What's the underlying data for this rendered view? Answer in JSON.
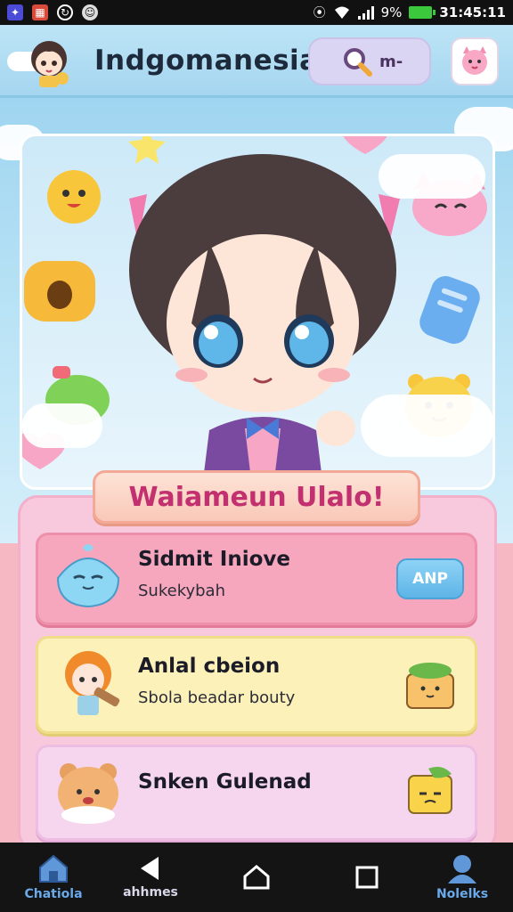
{
  "status_bar": {
    "battery": "9%",
    "time": "31:45:11"
  },
  "header": {
    "title": "Indgomanesia",
    "search_label": "m-"
  },
  "welcome": {
    "text": "Waiameun Ulalo!"
  },
  "cards": [
    {
      "title": "Sidmit Iniove",
      "subtitle": "Sukekybah",
      "button": "ANP"
    },
    {
      "title": "Anlal cbeion",
      "subtitle": "Sbola beadar bouty"
    },
    {
      "title": "Snken Gulenad"
    }
  ],
  "nav": {
    "home": "Chatiola",
    "back": "ahhmes",
    "notes": "Nolelks"
  },
  "colors": {
    "accent_pink": "#f6a6bd",
    "accent_blue": "#5db4e6",
    "title_magenta": "#c2306f"
  }
}
